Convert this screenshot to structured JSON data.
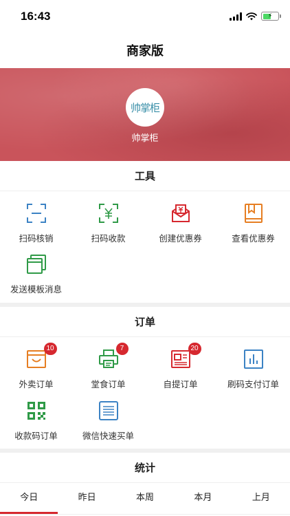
{
  "status_bar": {
    "time": "16:43"
  },
  "header": {
    "title": "商家版"
  },
  "banner": {
    "logo_text": "帅掌柜",
    "shop_name": "帅掌柜"
  },
  "tools": {
    "title": "工具",
    "items": [
      {
        "label": "扫码核销",
        "icon": "scan-verify-icon",
        "color": "#3b82c4"
      },
      {
        "label": "扫码收款",
        "icon": "scan-pay-icon",
        "color": "#2f9a47"
      },
      {
        "label": "创建优惠券",
        "icon": "coupon-envelope-icon",
        "color": "#d6282f"
      },
      {
        "label": "查看优惠券",
        "icon": "coupon-book-icon",
        "color": "#e67e22"
      },
      {
        "label": "发送模板消息",
        "icon": "template-message-icon",
        "color": "#2f9a47"
      }
    ]
  },
  "orders": {
    "title": "订单",
    "items": [
      {
        "label": "外卖订单",
        "icon": "takeaway-bag-icon",
        "color": "#e67e22",
        "badge": "10"
      },
      {
        "label": "堂食订单",
        "icon": "printer-icon",
        "color": "#2f9a47",
        "badge": "7"
      },
      {
        "label": "自提订单",
        "icon": "newspaper-icon",
        "color": "#d6282f",
        "badge": "20"
      },
      {
        "label": "刷码支付订单",
        "icon": "bar-chart-icon",
        "color": "#3b82c4"
      },
      {
        "label": "收款码订单",
        "icon": "qrcode-icon",
        "color": "#2f9a47"
      },
      {
        "label": "微信快速买单",
        "icon": "list-icon",
        "color": "#3b82c4"
      }
    ]
  },
  "stats": {
    "title": "统计",
    "tabs": [
      "今日",
      "昨日",
      "本周",
      "本月",
      "上月"
    ],
    "active_tab": "今日"
  },
  "colors": {
    "accent": "#d6282f",
    "banner": "#c9545b"
  }
}
